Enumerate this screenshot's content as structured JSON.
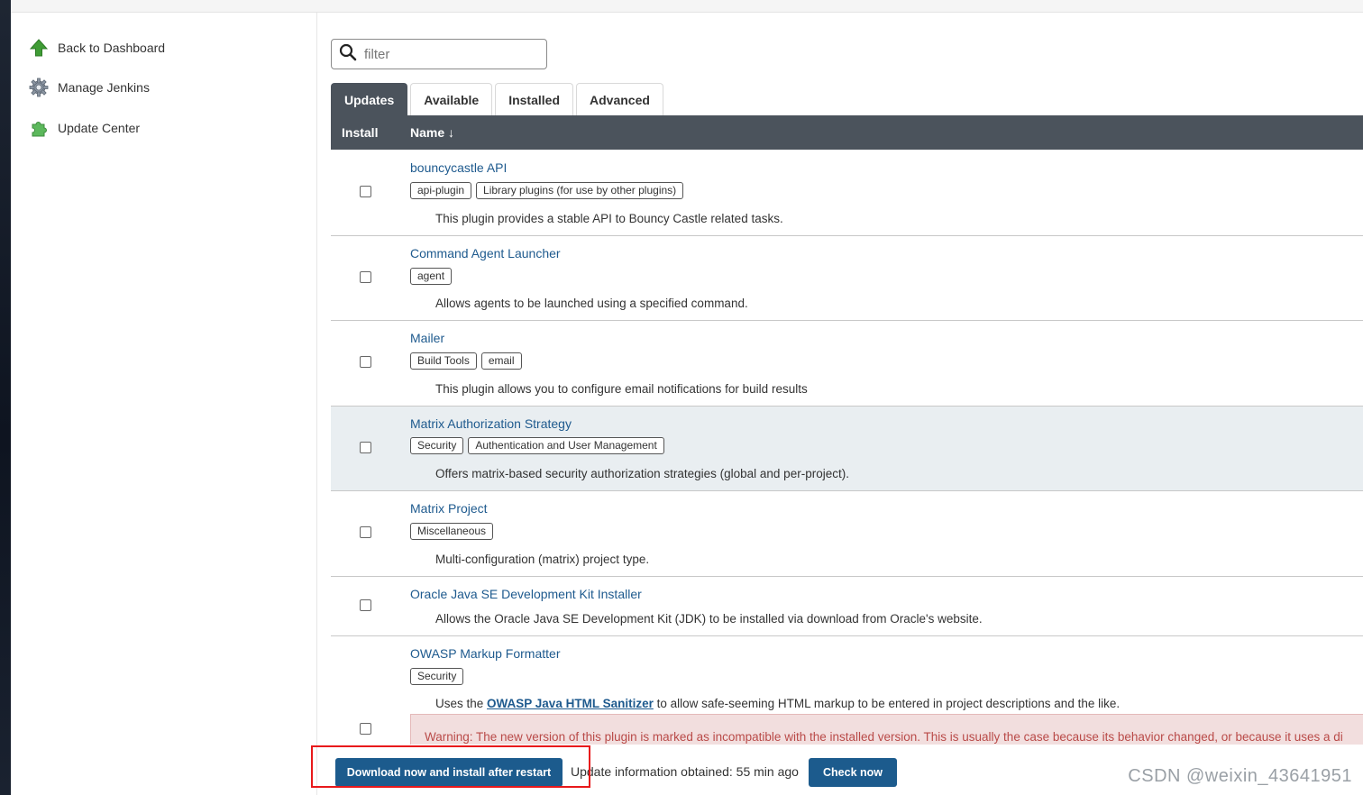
{
  "sidebar": {
    "items": [
      {
        "label": "Back to Dashboard",
        "icon": "up-arrow-icon"
      },
      {
        "label": "Manage Jenkins",
        "icon": "gear-icon"
      },
      {
        "label": "Update Center",
        "icon": "puzzle-icon"
      }
    ]
  },
  "filter": {
    "placeholder": "filter",
    "value": ""
  },
  "tabs": [
    {
      "label": "Updates",
      "active": true
    },
    {
      "label": "Available",
      "active": false
    },
    {
      "label": "Installed",
      "active": false
    },
    {
      "label": "Advanced",
      "active": false
    }
  ],
  "table": {
    "headers": {
      "install": "Install",
      "name": "Name ↓"
    },
    "rows": [
      {
        "name": "bouncycastle API",
        "tags": [
          "api-plugin",
          "Library plugins (for use by other plugins)"
        ],
        "description": "This plugin provides a stable API to Bouncy Castle related tasks."
      },
      {
        "name": "Command Agent Launcher",
        "tags": [
          "agent"
        ],
        "description": "Allows agents to be launched using a specified command."
      },
      {
        "name": "Mailer",
        "tags": [
          "Build Tools",
          "email"
        ],
        "description": "This plugin allows you to configure email notifications for build results"
      },
      {
        "name": "Matrix Authorization Strategy",
        "tags": [
          "Security",
          "Authentication and User Management"
        ],
        "description": "Offers matrix-based security authorization strategies (global and per-project)."
      },
      {
        "name": "Matrix Project",
        "tags": [
          "Miscellaneous"
        ],
        "description": "Multi-configuration (matrix) project type."
      },
      {
        "name": "Oracle Java SE Development Kit Installer",
        "tags": [],
        "description": "Allows the Oracle Java SE Development Kit (JDK) to be installed via download from Oracle's website."
      },
      {
        "name": "OWASP Markup Formatter",
        "tags": [
          "Security"
        ],
        "description_pre": "Uses the ",
        "description_link": "OWASP Java HTML Sanitizer",
        "description_post": " to allow safe-seeming HTML markup to be entered in project descriptions and the like.",
        "warning": "Warning: The new version of this plugin is marked as incompatible with the installed version. This is usually the case because its behavior changed, or because it uses a di"
      }
    ]
  },
  "bottom": {
    "download_label": "Download now and install after restart",
    "update_info": "Update information obtained: 55 min ago",
    "check_label": "Check now",
    "watermark": "CSDN @weixin_43641951"
  },
  "colors": {
    "header_bg": "#4b535c",
    "link": "#1e5a8e",
    "button": "#1c5b8d",
    "warning_bg": "#f2dede",
    "highlight": "#e9eef1",
    "annotation": "#e8191b"
  }
}
